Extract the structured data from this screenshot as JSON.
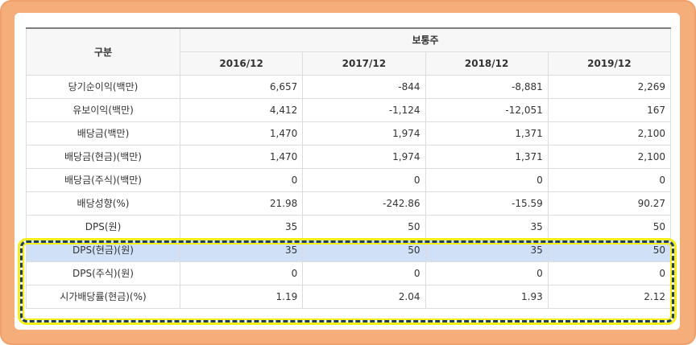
{
  "table": {
    "header": {
      "category": "구분",
      "group": "보통주",
      "years": [
        "2016/12",
        "2017/12",
        "2018/12",
        "2019/12"
      ]
    },
    "rows": [
      {
        "label": "당기순이익(백만)",
        "values": [
          "6,657",
          "-844",
          "-8,881",
          "2,269"
        ]
      },
      {
        "label": "유보이익(백만)",
        "values": [
          "4,412",
          "-1,124",
          "-12,051",
          "167"
        ]
      },
      {
        "label": "배당금(백만)",
        "values": [
          "1,470",
          "1,974",
          "1,371",
          "2,100"
        ]
      },
      {
        "label": "배당금(현금)(백만)",
        "values": [
          "1,470",
          "1,974",
          "1,371",
          "2,100"
        ]
      },
      {
        "label": "배당금(주식)(백만)",
        "values": [
          "0",
          "0",
          "0",
          "0"
        ]
      },
      {
        "label": "배당성향(%)",
        "values": [
          "21.98",
          "-242.86",
          "-15.59",
          "90.27"
        ]
      },
      {
        "label": "DPS(원)",
        "values": [
          "35",
          "50",
          "35",
          "50"
        ]
      },
      {
        "label": "DPS(현금)(원)",
        "values": [
          "35",
          "50",
          "35",
          "50"
        ]
      },
      {
        "label": "DPS(주식)(원)",
        "values": [
          "0",
          "0",
          "0",
          "0"
        ]
      },
      {
        "label": "시가배당률(현금)(%)",
        "values": [
          "1.19",
          "2.04",
          "1.93",
          "2.12"
        ]
      }
    ],
    "highlighted_row": 7
  },
  "colors": {
    "frame_orange": "#f5ad7a",
    "highlight_row_bg": "#cfe0f7",
    "dashed_outline": "#1f3e5a",
    "outline_glow": "#f4ee1a"
  }
}
